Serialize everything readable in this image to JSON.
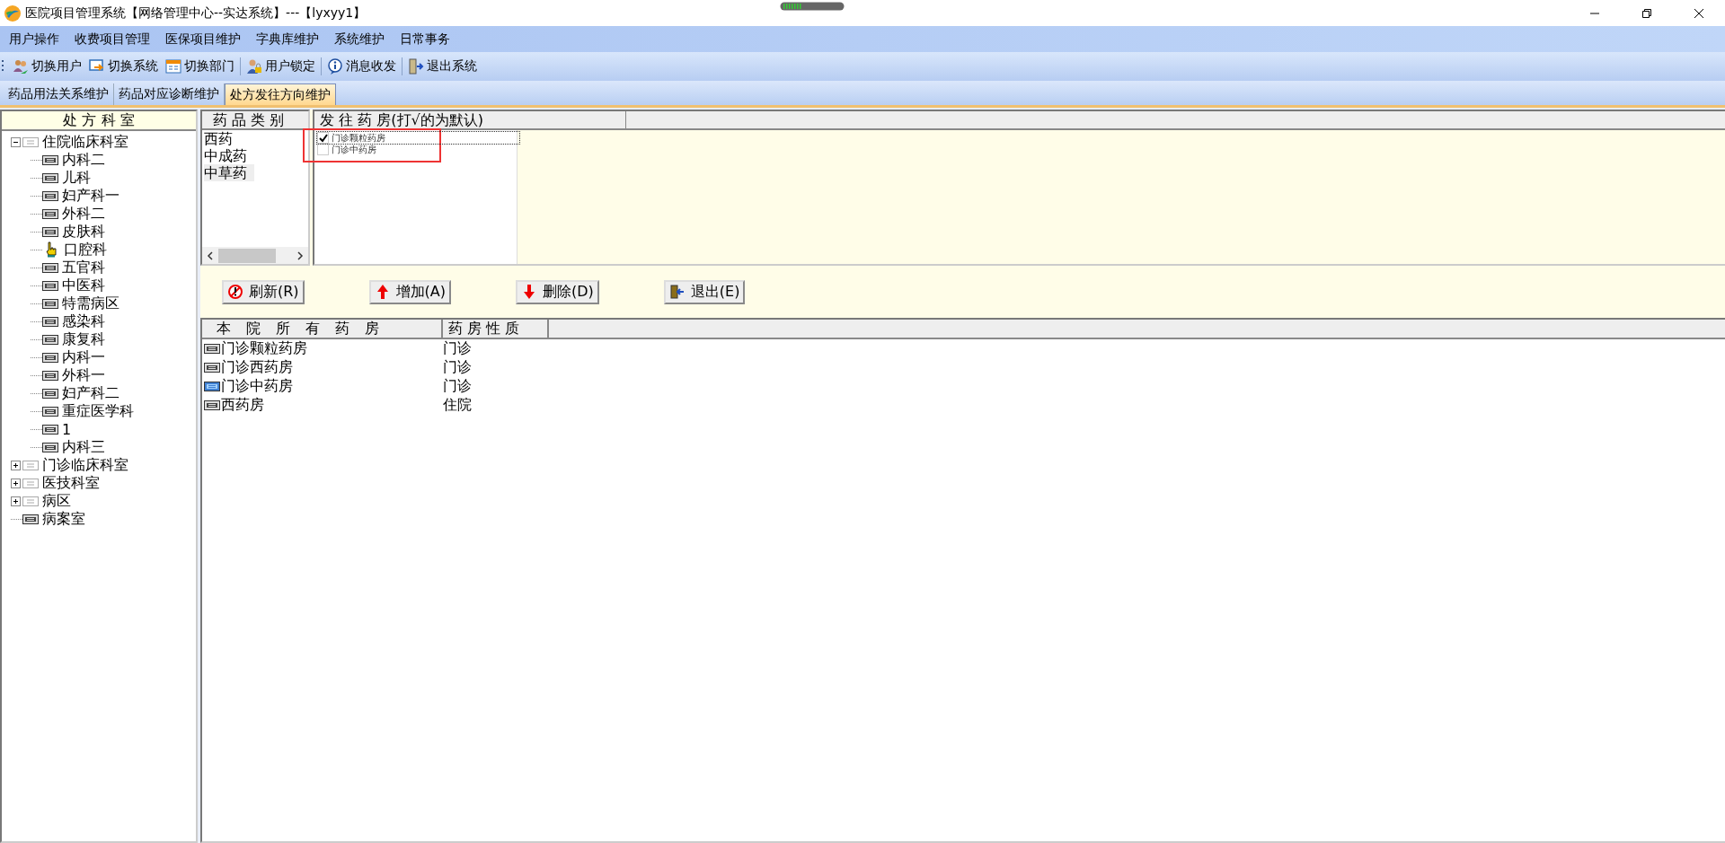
{
  "window": {
    "title": "医院项目管理系统【网络管理中心--实达系统】---【lyxyy1】"
  },
  "menu": [
    "用户操作",
    "收费项目管理",
    "医保项目维护",
    "字典库维护",
    "系统维护",
    "日常事务"
  ],
  "toolbar": [
    {
      "label": "切换用户",
      "kind": "users"
    },
    {
      "label": "切换系统",
      "kind": "switch"
    },
    {
      "label": "切换部门",
      "kind": "dept"
    },
    {
      "label": "用户锁定",
      "kind": "lock"
    },
    {
      "label": "消息收发",
      "kind": "info"
    },
    {
      "label": "退出系统",
      "kind": "exit"
    }
  ],
  "tabs": [
    {
      "label": "药品用法关系维护",
      "selected": false
    },
    {
      "label": "药品对应诊断维护",
      "selected": false
    },
    {
      "label": "处方发往方向维护",
      "selected": true
    }
  ],
  "tree": {
    "header": "处 方 科 室",
    "nodes": [
      {
        "label": "住院临床科室",
        "expanded": true,
        "children": [
          {
            "label": "内科二",
            "kind": "item"
          },
          {
            "label": "儿科",
            "kind": "item"
          },
          {
            "label": "妇产科一",
            "kind": "item"
          },
          {
            "label": "外科二",
            "kind": "item"
          },
          {
            "label": "皮肤科",
            "kind": "item"
          },
          {
            "label": "口腔科",
            "kind": "pointer"
          },
          {
            "label": "五官科",
            "kind": "item"
          },
          {
            "label": "中医科",
            "kind": "item"
          },
          {
            "label": "特需病区",
            "kind": "item"
          },
          {
            "label": "感染科",
            "kind": "item"
          },
          {
            "label": "康复科",
            "kind": "item"
          },
          {
            "label": "内科一",
            "kind": "item"
          },
          {
            "label": "外科一",
            "kind": "item"
          },
          {
            "label": "妇产科二",
            "kind": "item"
          },
          {
            "label": "重症医学科",
            "kind": "item"
          },
          {
            "label": "1",
            "kind": "item"
          },
          {
            "label": "内科三",
            "kind": "item"
          }
        ]
      },
      {
        "label": "门诊临床科室",
        "expanded": false
      },
      {
        "label": "医技科室",
        "expanded": false
      },
      {
        "label": "病区",
        "expanded": false
      },
      {
        "label": "病案室",
        "kind": "item"
      }
    ]
  },
  "categories": {
    "header": "药 品 类 别",
    "items": [
      {
        "label": "西药",
        "selected": false
      },
      {
        "label": "中成药",
        "selected": false
      },
      {
        "label": "中草药",
        "selected": true
      }
    ]
  },
  "targets": {
    "header": "发 往 药 房(打√的为默认)",
    "items": [
      {
        "label": "门诊颗粒药房",
        "checked": true
      },
      {
        "label": "门诊中药房",
        "checked": false
      }
    ]
  },
  "buttons": [
    {
      "label": "刷新(R)",
      "kind": "refresh"
    },
    {
      "label": "增加(A)",
      "kind": "add"
    },
    {
      "label": "删除(D)",
      "kind": "delete"
    },
    {
      "label": "退出(E)",
      "kind": "exit"
    }
  ],
  "pharmacies": {
    "columns": [
      "本 院 所 有 药 房",
      "药 房 性 质"
    ],
    "rows": [
      {
        "name": "门诊颗粒药房",
        "type": "门诊",
        "selected": false
      },
      {
        "name": "门诊西药房",
        "type": "门诊",
        "selected": false
      },
      {
        "name": "门诊中药房",
        "type": "门诊",
        "selected": true
      },
      {
        "name": "西药房",
        "type": "住院",
        "selected": false
      }
    ]
  }
}
